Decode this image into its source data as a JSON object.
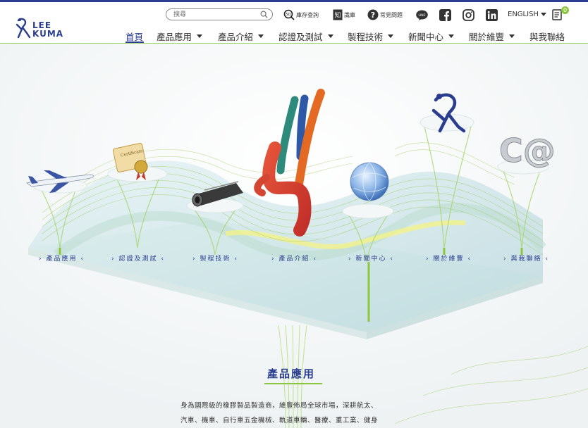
{
  "brand": {
    "line1": "LEE",
    "line2": "KUMA"
  },
  "search": {
    "placeholder": "搜尋"
  },
  "utility": {
    "stock": "庫存查詢",
    "knowledge": "識庫",
    "faq": "常見問題",
    "language": "ENGLISH",
    "inquiry_count": "0"
  },
  "nav": [
    {
      "label": "首頁"
    },
    {
      "label": "產品應用"
    },
    {
      "label": "產品介紹"
    },
    {
      "label": "認證及測試"
    },
    {
      "label": "製程技術"
    },
    {
      "label": "新聞中心"
    },
    {
      "label": "關於維豐"
    },
    {
      "label": "與我聯絡"
    }
  ],
  "hero_links": [
    {
      "label": "› 產品應用 ‹"
    },
    {
      "label": "› 認證及測試 ‹"
    },
    {
      "label": "› 製程技術 ‹"
    },
    {
      "label": "› 產品介紹 ‹"
    },
    {
      "label": "› 新聞中心 ‹"
    },
    {
      "label": "› 關於維豐 ‹"
    },
    {
      "label": "› 與我聯絡 ‹"
    }
  ],
  "section": {
    "title": "產品應用",
    "line1": "身為國際級的橡膠製品製造商，維豐佈局全球市場，深耕航太、",
    "line2": "汽車、機車、自行車五金機械、軌道車輛、醫療、重工業、健身"
  },
  "colors": {
    "brand_blue": "#2a3d8f",
    "accent_green": "#8cc63f"
  }
}
